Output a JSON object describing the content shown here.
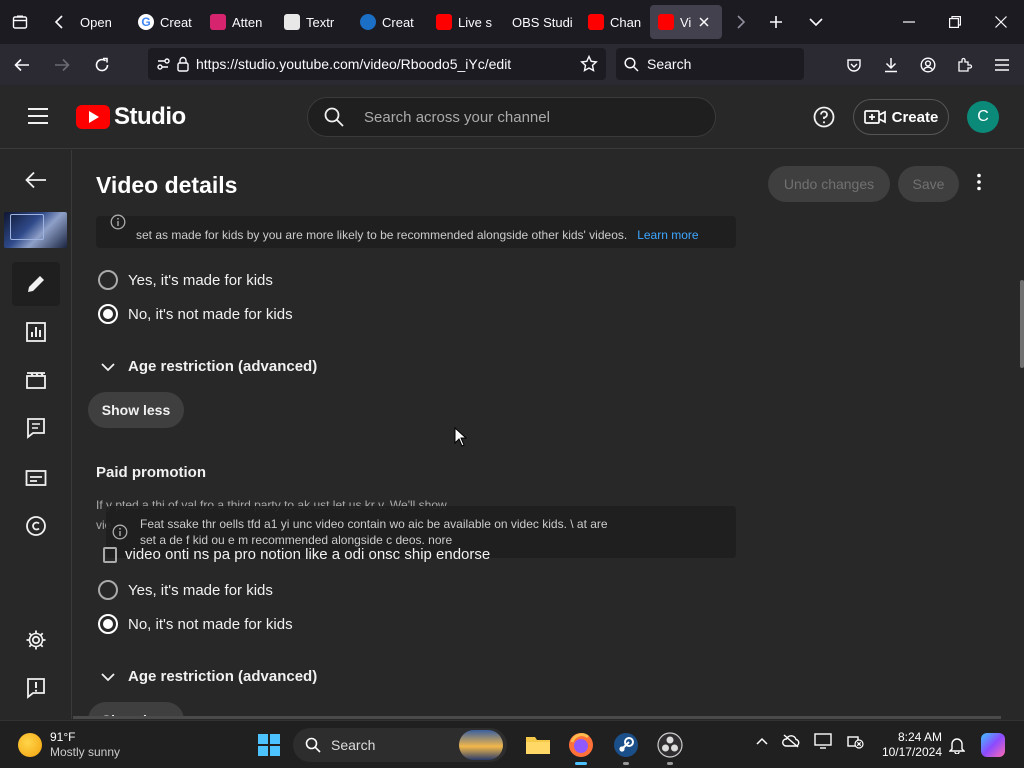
{
  "browser": {
    "tabs": [
      {
        "label": "Open",
        "fav_color": "#ff7139"
      },
      {
        "label": "Creat",
        "fav_color": "#4285f4"
      },
      {
        "label": "Atten",
        "fav_color": "#d6246e"
      },
      {
        "label": "Textr",
        "fav_color": "#e8e8e8"
      },
      {
        "label": "Creat",
        "fav_color": "#1b6fc5"
      },
      {
        "label": "Live s",
        "fav_color": "#ff0000"
      },
      {
        "label": "OBS Studi",
        "fav_color": ""
      },
      {
        "label": "Chan",
        "fav_color": "#ff0000"
      },
      {
        "label": "Vi",
        "fav_color": "#ff0000"
      }
    ],
    "url": "https://studio.youtube.com/video/Rboodo5_iYc/edit",
    "search_placeholder": "Search"
  },
  "studio": {
    "logo_text": "Studio",
    "search_placeholder": "Search across your channel",
    "create_label": "Create",
    "avatar_letter": "C"
  },
  "page": {
    "title": "Video details",
    "undo_label": "Undo changes",
    "save_label": "Save",
    "info_text": "set as made for kids by you are more likely to be recommended alongside other kids' videos.",
    "learn_more": "Learn more",
    "radio_yes": "Yes, it's made for kids",
    "radio_no": "No, it's not made for kids",
    "age_label": "Age restriction (advanced)",
    "show_less": "Show less",
    "paid_title": "Paid promotion",
    "paid_desc_1": "If y      pted a  thi    of val    fro  a third party to  ak              ust let us kr   v. We'll show",
    "paid_desc_2": "vie",
    "overlap_info_1": "Feat    ssake  thr    oells tfd a1 yi   unc  video contain  wo   aic  be available on videc                  kids. \\         at are",
    "overlap_info_2": "set a     de f  kid         ou      e  m                           recommended alongside c            deos.        nore",
    "checkbox_label": "video   onti   ns pa   pro  notion like a    odi                    onsc  ship    endorse",
    "radio_yes_2": "Yes, it's made for kids",
    "radio_no_2": "No, it's not made for kids",
    "age_label_2": "Age restriction (advanced)",
    "show_less_2": "Show less"
  },
  "taskbar": {
    "temp": "91°F",
    "weather": "Mostly sunny",
    "search_label": "Search",
    "time": "8:24 AM",
    "date": "10/17/2024"
  }
}
